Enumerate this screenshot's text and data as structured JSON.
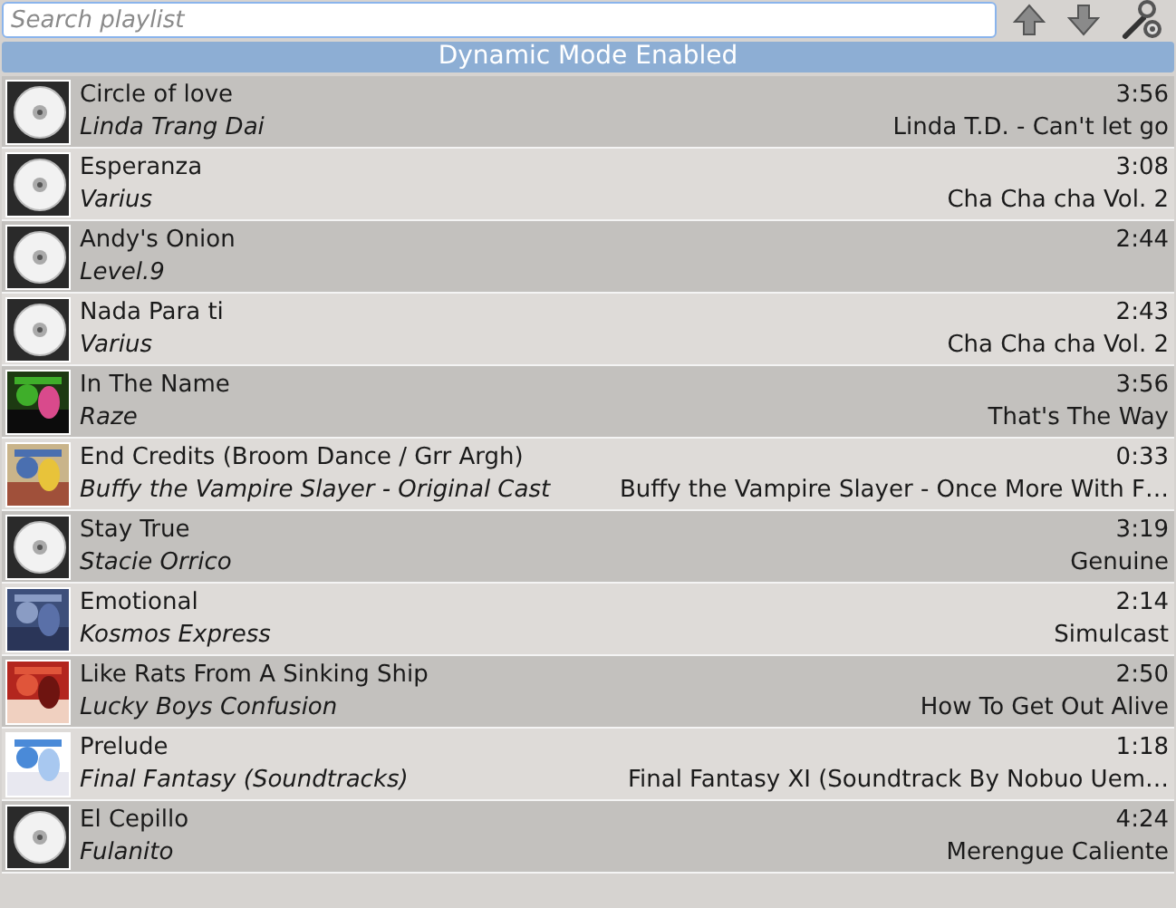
{
  "search": {
    "placeholder": "Search playlist"
  },
  "banner": "Dynamic Mode Enabled",
  "tracks": [
    {
      "title": "Circle of love",
      "artist": "Linda Trang Dai",
      "length": "3:56",
      "album": "Linda T.D.  - Can't let go",
      "cover": {
        "kind": "disc"
      }
    },
    {
      "title": "Esperanza",
      "artist": "Varius",
      "length": "3:08",
      "album": "Cha Cha cha Vol. 2",
      "cover": {
        "kind": "disc"
      }
    },
    {
      "title": "Andy's Onion",
      "artist": "Level.9",
      "length": "2:44",
      "cover": {
        "kind": "disc"
      }
    },
    {
      "title": "Nada Para ti",
      "artist": "Varius",
      "length": "2:43",
      "album": "Cha Cha cha Vol. 2",
      "cover": {
        "kind": "disc"
      }
    },
    {
      "title": "In The Name",
      "artist": "Raze",
      "length": "3:56",
      "album": "That's The Way"
    },
    {
      "title": "End Credits (Broom Dance / Grr Argh)",
      "artist": "Buffy the Vampire Slayer - Original Cast",
      "length": "0:33",
      "album": "Buffy the Vampire Slayer - Once More With F…"
    },
    {
      "title": "Stay True",
      "artist": "Stacie Orrico",
      "length": "3:19",
      "album": "Genuine",
      "cover": {
        "kind": "disc"
      }
    },
    {
      "title": "Emotional",
      "artist": "Kosmos Express",
      "length": "2:14",
      "album": "Simulcast"
    },
    {
      "title": "Like Rats From A Sinking Ship",
      "artist": "Lucky Boys Confusion",
      "length": "2:50",
      "album": "How To Get Out Alive"
    },
    {
      "title": "Prelude",
      "artist": "Final Fantasy (Soundtracks)",
      "length": "1:18",
      "album": "Final Fantasy XI (Soundtrack By Nobuo Uem…"
    },
    {
      "title": "El Cepillo",
      "artist": "Fulanito",
      "length": "4:24",
      "album": "Merengue Caliente",
      "cover": {
        "kind": "disc"
      }
    }
  ]
}
